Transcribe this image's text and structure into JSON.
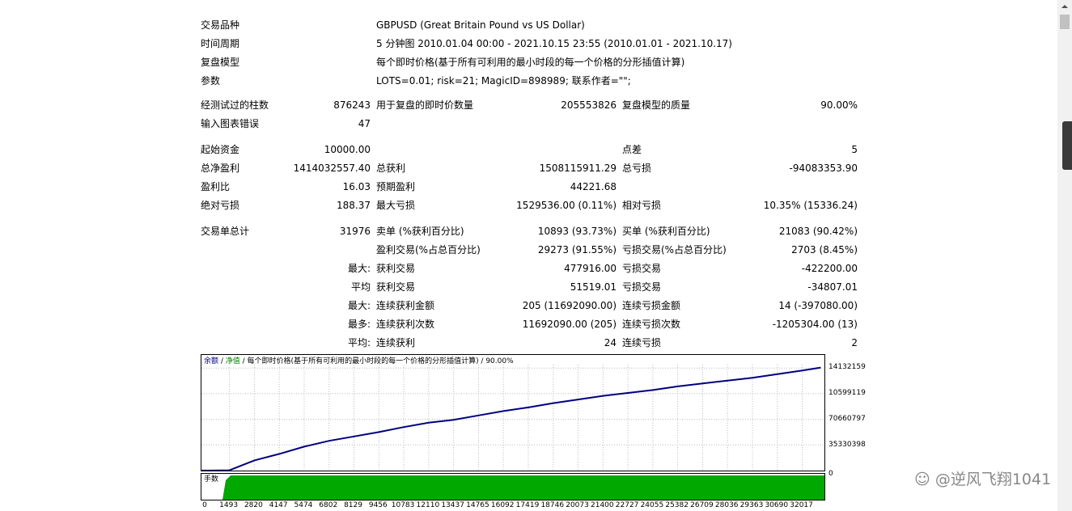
{
  "header_rows": [
    {
      "label": "交易品种",
      "value": "GBPUSD (Great Britain Pound vs US Dollar)"
    },
    {
      "label": "时间周期",
      "value": "5 分钟图 2010.01.04 00:00 - 2021.10.15 23:55 (2010.01.01 - 2021.10.17)"
    },
    {
      "label": "复盘模型",
      "value": "每个即时价格(基于所有可利用的最小时段的每一个价格的分形插值计算)"
    },
    {
      "label": "参数",
      "value": "LOTS=0.01; risk=21; MagicID=898989; 联系作者=\"\";"
    }
  ],
  "stats_rows": [
    {
      "c1": "经测试过的柱数",
      "v1": "876243",
      "c2": "用于复盘的即时价数量",
      "v2": "205553826",
      "c3": "复盘模型的质量",
      "v3": "90.00%"
    },
    {
      "c1": "输入图表错误",
      "v1": "47",
      "c2": "",
      "v2": "",
      "c3": "",
      "v3": ""
    },
    {
      "c1": "起始资金",
      "v1": "10000.00",
      "c2": "",
      "v2": "",
      "c3": "点差",
      "v3": "5"
    },
    {
      "c1": "总净盈利",
      "v1": "1414032557.40",
      "c2": "总获利",
      "v2": "1508115911.29",
      "c3": "总亏损",
      "v3": "-94083353.90"
    },
    {
      "c1": "盈利比",
      "v1": "16.03",
      "c2": "预期盈利",
      "v2": "44221.68",
      "c3": "",
      "v3": ""
    },
    {
      "c1": "绝对亏损",
      "v1": "188.37",
      "c2": "最大亏损",
      "v2": "1529536.00 (0.11%)",
      "c3": "相对亏损",
      "v3": "10.35% (15336.24)"
    },
    {
      "c1": "交易单总计",
      "v1": "31976",
      "c2": "卖单 (%获利百分比)",
      "v2": "10893 (93.73%)",
      "c3": "买单 (%获利百分比)",
      "v3": "21083 (90.42%)"
    },
    {
      "c1": "",
      "v1": "",
      "c2": "盈利交易(%占总百分比)",
      "v2": "29273 (91.55%)",
      "c3": "亏损交易(%占总百分比)",
      "v3": "2703 (8.45%)"
    },
    {
      "c1": "",
      "v1": "最大:",
      "c2": "获利交易",
      "v2": "477916.00",
      "c3": "亏损交易",
      "v3": "-422200.00"
    },
    {
      "c1": "",
      "v1": "平均",
      "c2": "获利交易",
      "v2": "51519.01",
      "c3": "亏损交易",
      "v3": "-34807.01"
    },
    {
      "c1": "",
      "v1": "最大:",
      "c2": "连续获利金额",
      "v2": "205 (11692090.00)",
      "c3": "连续亏损金额",
      "v3": "14 (-397080.00)"
    },
    {
      "c1": "",
      "v1": "最多:",
      "c2": "连续获利次数",
      "v2": "11692090.00 (205)",
      "c3": "连续亏损次数",
      "v3": "-1205304.00 (13)"
    },
    {
      "c1": "",
      "v1": "平均:",
      "c2": "连续获利",
      "v2": "24",
      "c3": "连续亏损",
      "v3": "2"
    }
  ],
  "chart": {
    "legend_balance": "余额",
    "legend_sep1": " / ",
    "legend_equity": "净值",
    "legend_rest": " / 每个即时价格(基于所有可利用的最小时段的每一个价格的分形插值计算) / 90.00%",
    "balance_color": "#000080",
    "equity_color": "#008000",
    "volume_label": "手数",
    "volume_color": "#00a800"
  },
  "chart_data": {
    "type": "line",
    "x_ticks": [
      "0",
      "1493",
      "2820",
      "4147",
      "5474",
      "6802",
      "8129",
      "9456",
      "10783",
      "12110",
      "13437",
      "14765",
      "16092",
      "17419",
      "18746",
      "20073",
      "21400",
      "22727",
      "24055",
      "25382",
      "26709",
      "28036",
      "29363",
      "30690",
      "32017"
    ],
    "y_ticks": [
      "0",
      "35330398",
      "70660797",
      "10599119",
      "14132159"
    ],
    "ylim": [
      0,
      146000000
    ],
    "xlim": [
      0,
      33200
    ],
    "series": [
      {
        "name": "余额",
        "x": [
          0,
          1493,
          2820,
          4147,
          5474,
          6802,
          8129,
          9456,
          10783,
          12110,
          13437,
          14765,
          16092,
          17419,
          18746,
          20073,
          21400,
          22727,
          24055,
          25382,
          26709,
          28036,
          29363,
          30690,
          32017,
          33000
        ],
        "values": [
          10000,
          500000,
          14000000,
          23000000,
          33000000,
          41000000,
          47000000,
          53000000,
          60000000,
          66000000,
          70000000,
          76000000,
          82000000,
          87000000,
          93000000,
          98000000,
          103000000,
          107000000,
          111000000,
          116000000,
          120000000,
          124000000,
          128000000,
          133000000,
          138000000,
          142000000
        ]
      }
    ]
  }
}
